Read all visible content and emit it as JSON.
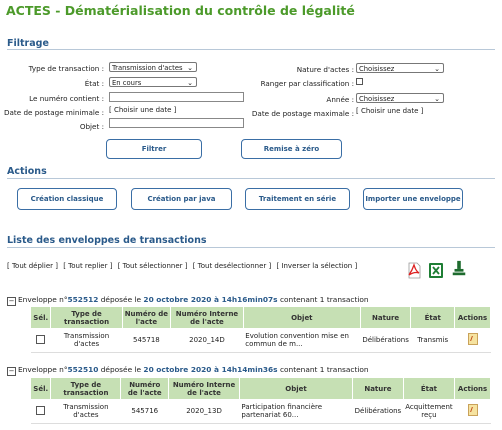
{
  "title": "ACTES - Dématérialisation du contrôle de légalité",
  "filtrage": {
    "heading": "Filtrage",
    "type_transaction_label": "Type de transaction :",
    "type_transaction_value": "Transmission d'actes",
    "etat_label": "État :",
    "etat_value": "En cours",
    "numero_label": "Le numéro contient :",
    "date_min_label": "Date de postage minimale :",
    "date_min_value": "[ Choisir une date ]",
    "objet_label": "Objet :",
    "nature_label": "Nature d'actes :",
    "nature_value": "Choisissez",
    "ranger_label": "Ranger par classification :",
    "annee_label": "Année :",
    "annee_value": "Choisissez",
    "date_max_label": "Date de postage maximale :",
    "date_max_value": "[ Choisir une date ]",
    "filtrer_label": "Filtrer",
    "reset_label": "Remise à zéro"
  },
  "actions": {
    "heading": "Actions",
    "buttons": [
      "Création classique",
      "Création par java",
      "Traitement en série",
      "Importer une enveloppe"
    ]
  },
  "list": {
    "heading": "Liste des enveloppes de transactions",
    "links": [
      "[ Tout déplier ]",
      "[ Tout replier ]",
      "[ Tout sélectionner ]",
      "[ Tout desélectionner ]",
      "[ Inverser la sélection ]"
    ],
    "icons": [
      "pdf-export-icon",
      "excel-export-icon",
      "stamp-icon"
    ]
  },
  "table_headers": {
    "sel": "Sél.",
    "type": "Type de transaction",
    "numero": "Numéro de l'acte",
    "numero_interne": "Numéro Interne de l'acte",
    "objet": "Objet",
    "nature": "Nature",
    "etat": "État",
    "actions": "Actions"
  },
  "envelopes": [
    {
      "prefix": "Enveloppe n°",
      "number": "552512",
      "mid": " déposée le ",
      "date": "20 octobre 2020 à 14h16min07s",
      "suffix": " contenant 1 transaction",
      "row": {
        "type": "Transmission d'actes",
        "numero": "545718",
        "numero_interne": "2020_14D",
        "objet": "Evolution convention mise en commun de m...",
        "nature": "Délibérations",
        "etat": "Transmis"
      }
    },
    {
      "prefix": "Enveloppe n°",
      "number": "552510",
      "mid": " déposée le ",
      "date": "20 octobre 2020 à 14h14min36s",
      "suffix": " contenant 1 transaction",
      "row": {
        "type": "Transmission d'actes",
        "numero": "545716",
        "numero_interne": "2020_13D",
        "objet": "Participation financière partenariat 60...",
        "nature": "Délibérations",
        "etat": "Acquittement reçu"
      }
    }
  ]
}
